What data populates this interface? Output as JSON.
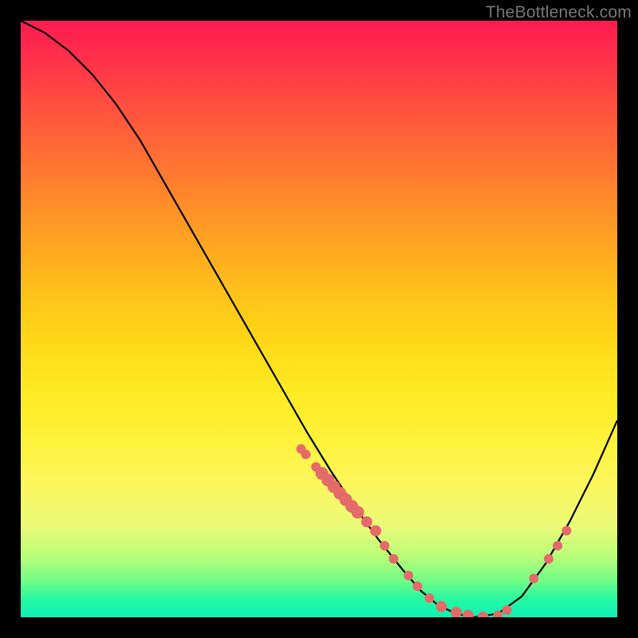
{
  "watermark": "TheBottleneck.com",
  "colors": {
    "background": "#000000",
    "curve": "#000000",
    "marker": "#e46b69",
    "gradient_top": "#ff1a52",
    "gradient_bottom": "#0df2b6"
  },
  "chart_data": {
    "type": "line",
    "title": "",
    "xlabel": "",
    "ylabel": "",
    "xlim": [
      0,
      100
    ],
    "ylim": [
      0,
      100
    ],
    "grid": false,
    "curve": {
      "x": [
        0,
        4,
        8,
        12,
        16,
        20,
        24,
        28,
        32,
        36,
        40,
        44,
        48,
        52,
        56,
        60,
        64,
        67,
        70,
        73,
        76,
        80,
        84,
        88,
        92,
        96,
        100
      ],
      "y": [
        100,
        98,
        95,
        91,
        86,
        80,
        73,
        66,
        59,
        52,
        45,
        38,
        31,
        24.5,
        18.5,
        13,
        8,
        4.5,
        2,
        0.6,
        0,
        0.6,
        3.5,
        9,
        16,
        24,
        33
      ]
    },
    "markers": {
      "note": "scatter points along the curve (decorative data markers)",
      "x": [
        47,
        47.8,
        49.5,
        50.5,
        51.5,
        52.5,
        53.5,
        54.5,
        55.5,
        56.5,
        58,
        59.5,
        61,
        62.5,
        65,
        66.5,
        68.5,
        70.5,
        73,
        75,
        77.5,
        80,
        81.5,
        86,
        88.5,
        90,
        91.5
      ],
      "y": [
        28.2,
        27.3,
        25.2,
        24.1,
        23.0,
        21.9,
        20.8,
        19.7,
        18.6,
        17.6,
        16.0,
        14.5,
        12.0,
        9.8,
        7.0,
        5.2,
        3.2,
        1.8,
        0.8,
        0.3,
        0.0,
        0.3,
        1.2,
        6.5,
        9.8,
        12.0,
        14.5
      ],
      "r": [
        6,
        6,
        6,
        8,
        8,
        8,
        8,
        8,
        8,
        8,
        7,
        7,
        6,
        6,
        6,
        6,
        6,
        7,
        7,
        7,
        7,
        6,
        6,
        6,
        6,
        6,
        6
      ]
    }
  }
}
